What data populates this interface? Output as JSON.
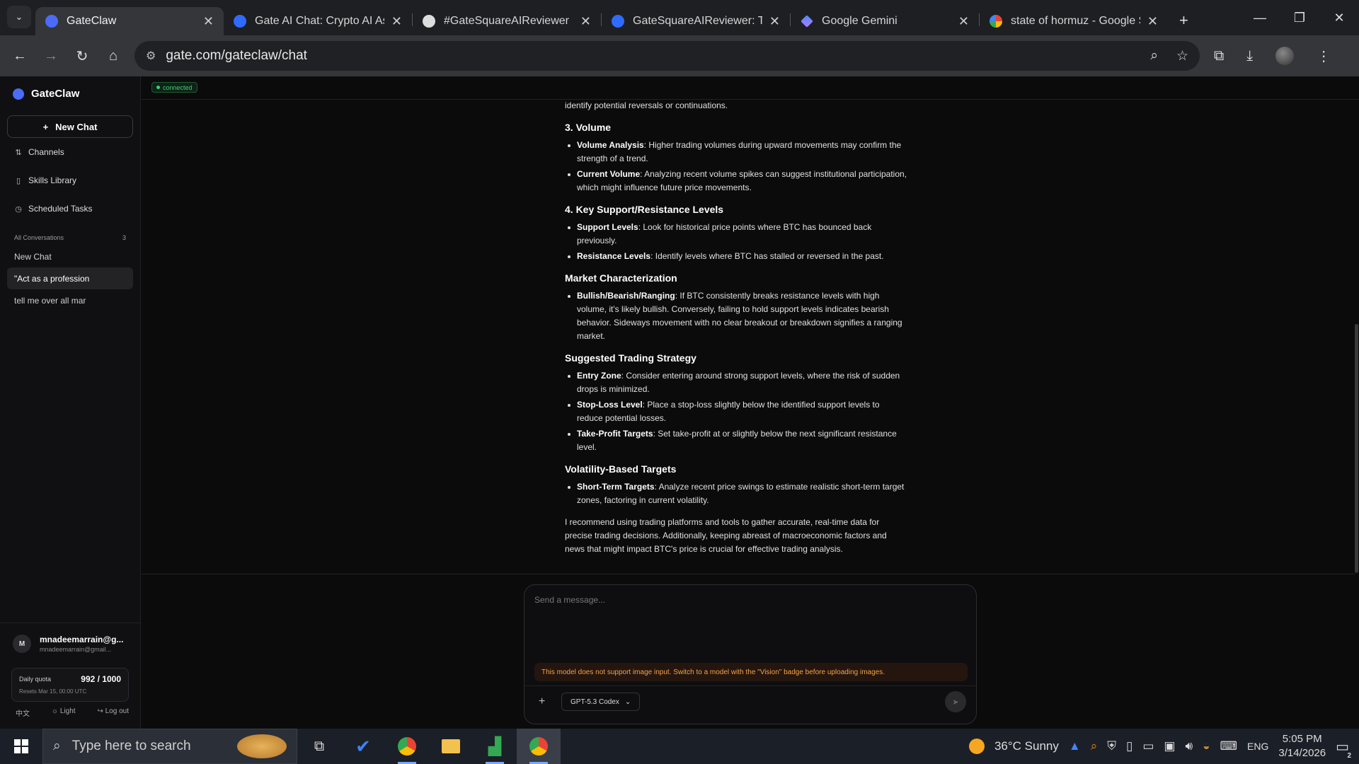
{
  "browser": {
    "tabs": [
      {
        "title": "GateClaw",
        "active": true
      },
      {
        "title": "Gate AI Chat: Crypto AI Assistant"
      },
      {
        "title": "#GateSquareAIReviewer"
      },
      {
        "title": "GateSquareAIReviewer: Today"
      },
      {
        "title": "Google Gemini"
      },
      {
        "title": "state of hormuz - Google Search"
      }
    ],
    "url": "gate.com/gateclaw/chat"
  },
  "sidebar": {
    "brand": "GateClaw",
    "new_chat": "New Chat",
    "links": [
      {
        "label": "Channels",
        "icon": "channels-icon"
      },
      {
        "label": "Skills Library",
        "icon": "book-icon"
      },
      {
        "label": "Scheduled Tasks",
        "icon": "clock-icon"
      }
    ],
    "conversations_header": "All Conversations",
    "conversations_count": "3",
    "conversations": [
      {
        "label": "New Chat"
      },
      {
        "label": "\"Act as a profession",
        "selected": true
      },
      {
        "label": "tell me over all mar"
      }
    ],
    "user": {
      "initial": "M",
      "name": "mnadeemarrain@g...",
      "email": "mnadeemarrain@gmail..."
    },
    "quota": {
      "label": "Daily quota",
      "value": "992 / 1000",
      "reset": "Resets Mar 15, 00:00 UTC"
    },
    "footer": {
      "lang": "中文",
      "theme": "Light",
      "logout": "Log out"
    }
  },
  "main": {
    "status": "connected",
    "intro_tail": "identify potential reversals or continuations.",
    "sections": [
      {
        "heading": "3. Volume",
        "items": [
          {
            "term": "Volume Analysis",
            "text": ": Higher trading volumes during upward movements may confirm the strength of a trend."
          },
          {
            "term": "Current Volume",
            "text": ": Analyzing recent volume spikes can suggest institutional participation, which might influence future price movements."
          }
        ]
      },
      {
        "heading": "4. Key Support/Resistance Levels",
        "items": [
          {
            "term": "Support Levels",
            "text": ": Look for historical price points where BTC has bounced back previously."
          },
          {
            "term": "Resistance Levels",
            "text": ": Identify levels where BTC has stalled or reversed in the past."
          }
        ]
      },
      {
        "heading": "Market Characterization",
        "items": [
          {
            "term": "Bullish/Bearish/Ranging",
            "text": ": If BTC consistently breaks resistance levels with high volume, it's likely bullish. Conversely, failing to hold support levels indicates bearish behavior. Sideways movement with no clear breakout or breakdown signifies a ranging market."
          }
        ]
      },
      {
        "heading": "Suggested Trading Strategy",
        "items": [
          {
            "term": "Entry Zone",
            "text": ": Consider entering around strong support levels, where the risk of sudden drops is minimized."
          },
          {
            "term": "Stop-Loss Level",
            "text": ": Place a stop-loss slightly below the identified support levels to reduce potential losses."
          },
          {
            "term": "Take-Profit Targets",
            "text": ": Set take-profit at or slightly below the next significant resistance level."
          }
        ]
      },
      {
        "heading": "Volatility-Based Targets",
        "items": [
          {
            "term": "Short-Term Targets",
            "text": ": Analyze recent price swings to estimate realistic short-term target zones, factoring in current volatility."
          }
        ]
      }
    ],
    "closing": "I recommend using trading platforms and tools to gather accurate, real-time data for precise trading decisions. Additionally, keeping abreast of macroeconomic factors and news that might impact BTC's price is crucial for effective trading analysis.",
    "composer": {
      "placeholder": "Send a message...",
      "warning": "This model does not support image input. Switch to a model with the \"Vision\" badge before uploading images.",
      "model": "GPT-5.3 Codex"
    }
  },
  "taskbar": {
    "search_placeholder": "Type here to search",
    "weather": "36°C  Sunny",
    "lang": "ENG",
    "time": "5:05 PM",
    "date": "3/14/2026",
    "notifications": "2"
  },
  "colors": {
    "accent": "#4a6cf7",
    "status_green": "#3ecf6e",
    "warning": "#f5a24a"
  }
}
